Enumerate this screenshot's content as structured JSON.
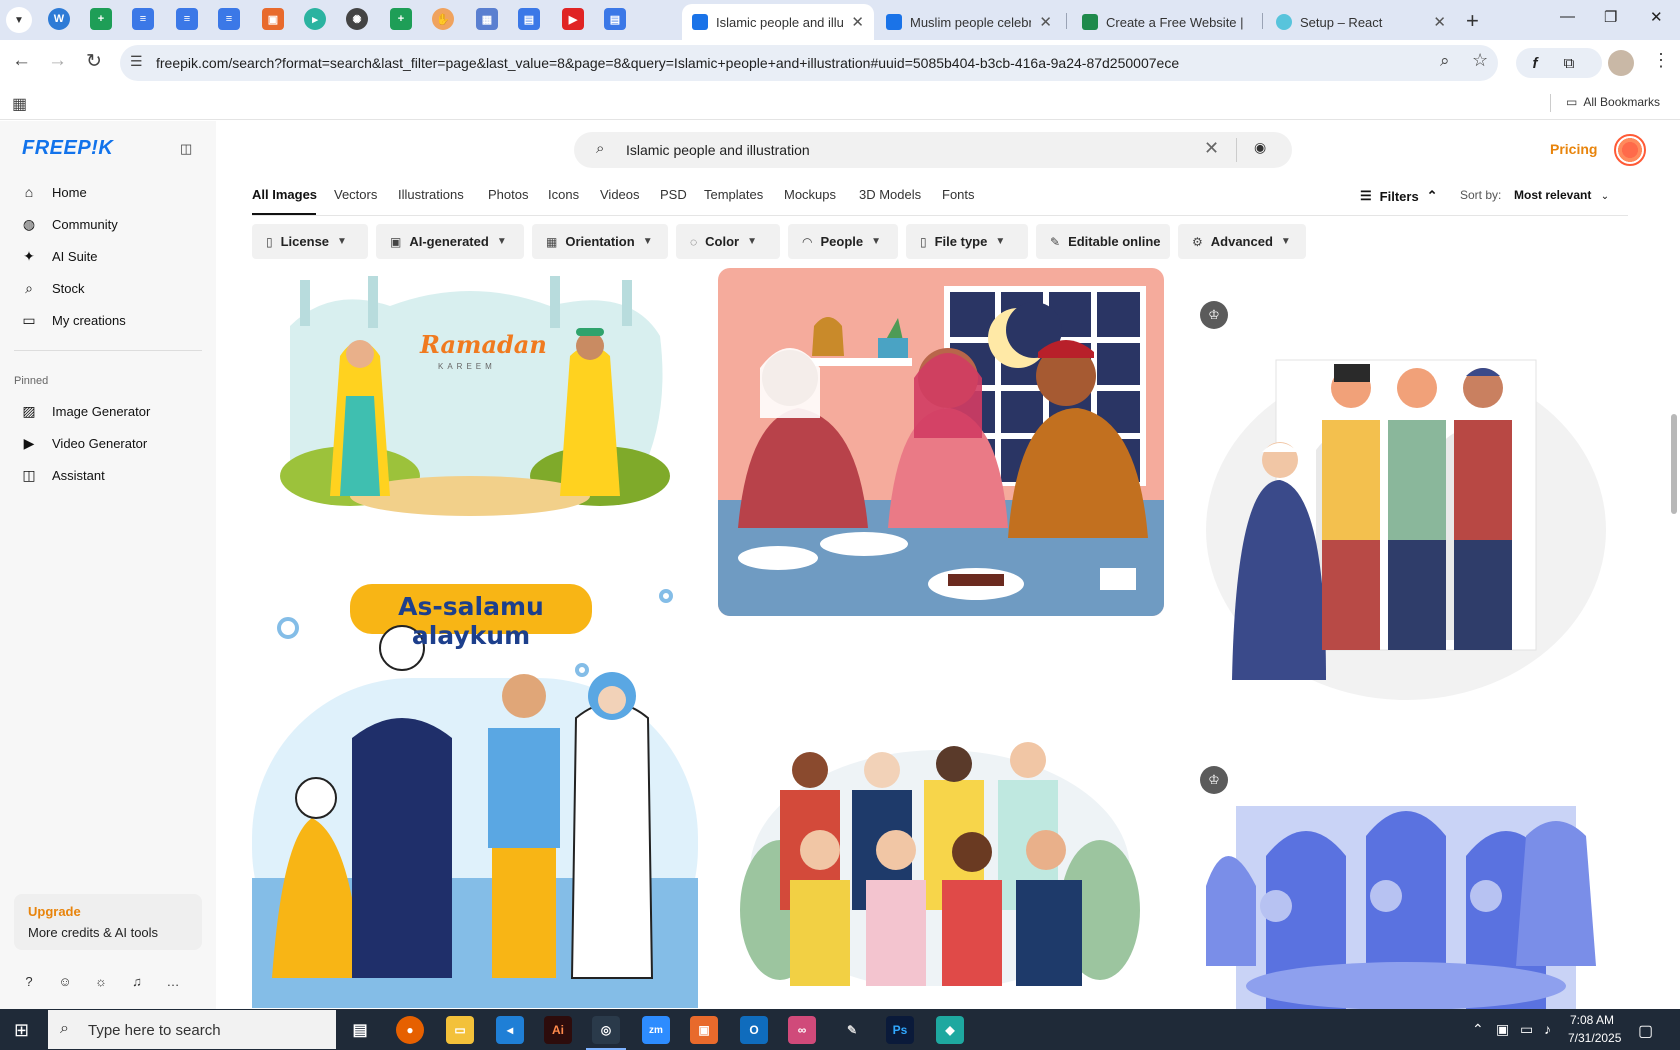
{
  "browser": {
    "tabs": [
      {
        "title": "Islamic people and illus",
        "active": true,
        "favicon_color": "#1a73e8"
      },
      {
        "title": "Muslim people celebra",
        "active": false,
        "favicon_color": "#1a73e8"
      },
      {
        "title": "Create a Free Website |",
        "active": false,
        "favicon_color": "#1f8a4c"
      },
      {
        "title": "Setup – React",
        "active": false,
        "favicon_color": "#58c4dc"
      }
    ],
    "url": "freepik.com/search?format=search&last_filter=page&last_value=8&page=8&query=Islamic+people+and+illustration#uuid=5085b404-b3cb-416a-9a24-87d250007ece",
    "bookmarks_label": "All Bookmarks"
  },
  "sidebar": {
    "logo": "FREEP!K",
    "items": [
      {
        "label": "Home",
        "icon": "home-icon",
        "glyph": "⌂"
      },
      {
        "label": "Community",
        "icon": "globe-icon",
        "glyph": "◍"
      },
      {
        "label": "AI Suite",
        "icon": "sparkle-icon",
        "glyph": "✦"
      },
      {
        "label": "Stock",
        "icon": "search-icon",
        "glyph": "⌕"
      },
      {
        "label": "My creations",
        "icon": "folder-icon",
        "glyph": "▭"
      }
    ],
    "pinned_label": "Pinned",
    "pinned": [
      {
        "label": "Image Generator",
        "icon": "image-icon",
        "glyph": "▨"
      },
      {
        "label": "Video Generator",
        "icon": "video-icon",
        "glyph": "▶"
      },
      {
        "label": "Assistant",
        "icon": "chat-icon",
        "glyph": "◫"
      }
    ],
    "upgrade": {
      "title": "Upgrade",
      "subtitle": "More credits & AI tools"
    }
  },
  "search": {
    "value": "Islamic people and illustration"
  },
  "header": {
    "pricing": "Pricing"
  },
  "categories": [
    "All Images",
    "Vectors",
    "Illustrations",
    "Photos",
    "Icons",
    "Videos",
    "PSD",
    "Templates",
    "Mockups",
    "3D Models",
    "Fonts"
  ],
  "filters_label": "Filters",
  "sort": {
    "label": "Sort by:",
    "value": "Most relevant"
  },
  "chips": [
    "License",
    "AI-generated",
    "Orientation",
    "Color",
    "People",
    "File type",
    "Editable online",
    "Advanced"
  ],
  "images": {
    "ramadan_title": "Ramadan",
    "ramadan_sub": "KAREEM",
    "salam_title": "As-salamu alaykum"
  },
  "taskbar": {
    "search_placeholder": "Type here to search",
    "time": "7:08 AM",
    "date": "7/31/2025"
  },
  "colors": {
    "brand": "#1273eb",
    "accent": "#e8840c"
  }
}
